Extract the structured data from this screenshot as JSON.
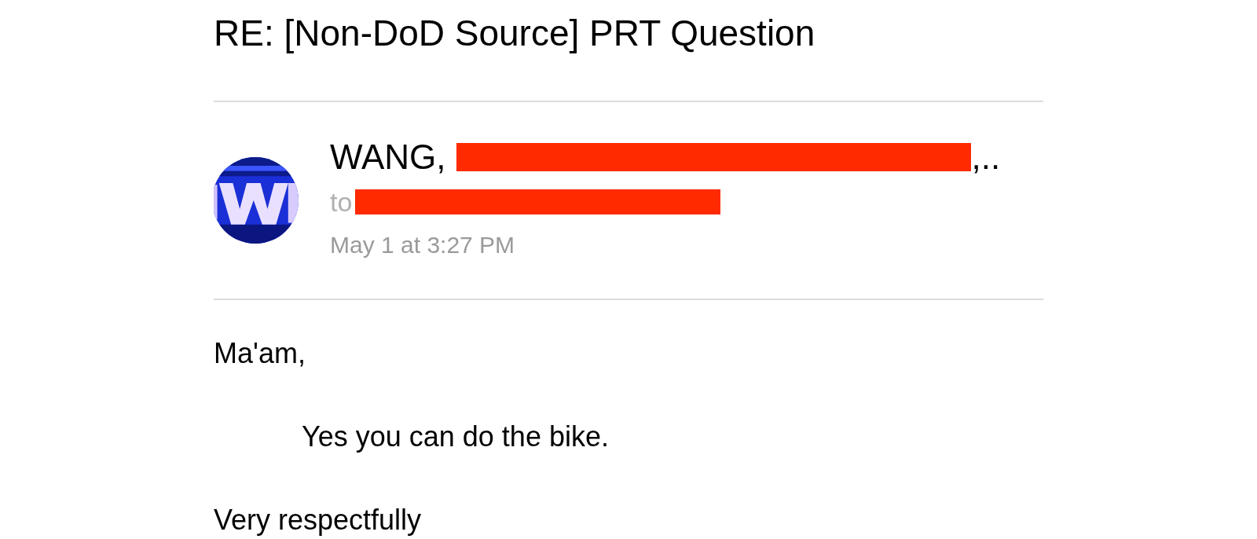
{
  "subject": "RE: [Non-DoD Source] PRT Question",
  "sender": {
    "name": "WANG,",
    "redacted": true,
    "more": ",.."
  },
  "recipient": {
    "prefix": "to",
    "redacted": true
  },
  "date": "May 1 at 3:27 PM",
  "body": [
    {
      "kind": "line",
      "text": "Ma'am,"
    },
    {
      "kind": "indented",
      "text": "Yes you can do the bike."
    },
    {
      "kind": "line",
      "text": "Very respectfully"
    }
  ]
}
